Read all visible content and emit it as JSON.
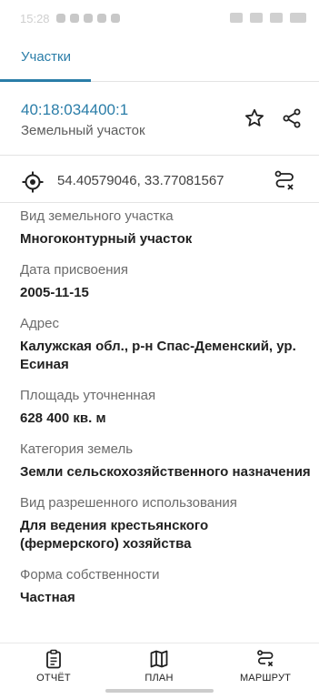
{
  "status_bar": {
    "time": "15:28"
  },
  "tabs": [
    {
      "label": "Участки"
    }
  ],
  "parcel": {
    "cadastral_number": "40:18:034400:1",
    "object_type": "Земельный участок",
    "coordinates": "54.40579046, 33.77081567"
  },
  "properties": [
    {
      "label": "Вид земельного участка",
      "value": "Многоконтурный участок"
    },
    {
      "label": "Дата присвоения",
      "value": "2005-11-15"
    },
    {
      "label": "Адрес",
      "value": "Калужская обл., р-н Спас-Деменский, ур. Есиная"
    },
    {
      "label": "Площадь уточненная",
      "value": "628 400 кв. м"
    },
    {
      "label": "Категория земель",
      "value": "Земли сельскохозяйственного назначения"
    },
    {
      "label": "Вид разрешенного использования",
      "value": "Для ведения крестьянского (фермерского) хозяйства"
    },
    {
      "label": "Форма собственности",
      "value": "Частная"
    }
  ],
  "bottom_nav": {
    "report": "ОТЧЁТ",
    "plan": "ПЛАН",
    "route": "МАРШРУТ"
  },
  "colors": {
    "accent": "#2a7da8",
    "text": "#212121",
    "label": "#6b6b6b"
  },
  "icons": {
    "favorite": "star-icon",
    "share": "share-icon",
    "location": "crosshair-icon",
    "route": "route-icon",
    "report": "clipboard-icon",
    "plan": "map-icon"
  }
}
